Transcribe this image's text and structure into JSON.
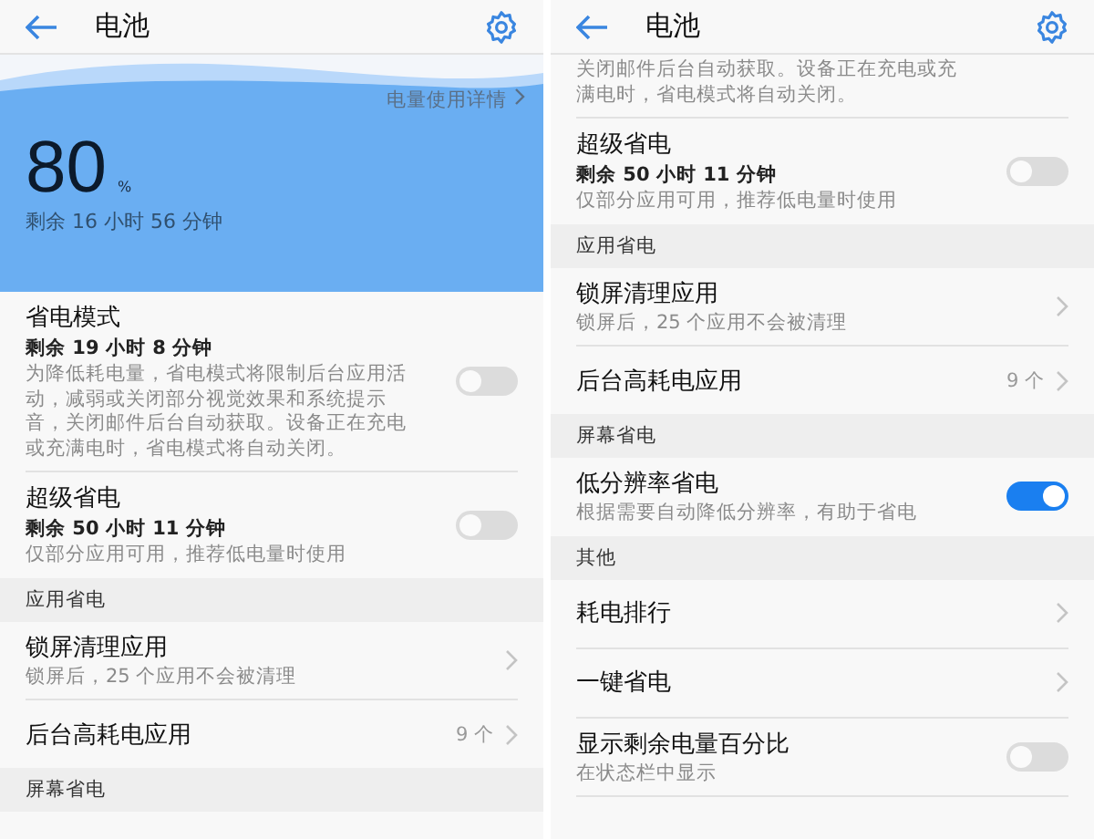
{
  "screens": [
    {
      "title": "电池",
      "hero": {
        "percent": "80",
        "unit": "%",
        "remaining": "剩余 16 小时 56 分钟",
        "details_link": "电量使用详情"
      },
      "rows": [
        {
          "kind": "toggle",
          "title": "省电模式",
          "subtitle": "剩余 19 小时 8 分钟",
          "description": "为降低耗电量，省电模式将限制后台应用活动，减弱或关闭部分视觉效果和系统提示音，关闭邮件后台自动获取。设备正在充电或充满电时，省电模式将自动关闭。",
          "on": false
        },
        {
          "kind": "toggle",
          "title": "超级省电",
          "subtitle": "剩余 50 小时 11 分钟",
          "description": "仅部分应用可用，推荐低电量时使用",
          "on": false
        },
        {
          "kind": "header",
          "title": "应用省电"
        },
        {
          "kind": "link",
          "title": "锁屏清理应用",
          "description": "锁屏后，25 个应用不会被清理"
        },
        {
          "kind": "link",
          "title": "后台高耗电应用",
          "value": "9 个"
        },
        {
          "kind": "header",
          "title": "屏幕省电"
        }
      ]
    },
    {
      "title": "电池",
      "rows": [
        {
          "kind": "fragment",
          "description": "关闭邮件后台自动获取。设备正在充电或充满电时，省电模式将自动关闭。"
        },
        {
          "kind": "toggle",
          "title": "超级省电",
          "subtitle": "剩余 50 小时 11 分钟",
          "description": "仅部分应用可用，推荐低电量时使用",
          "on": false
        },
        {
          "kind": "header",
          "title": "应用省电"
        },
        {
          "kind": "link",
          "title": "锁屏清理应用",
          "description": "锁屏后，25 个应用不会被清理"
        },
        {
          "kind": "link",
          "title": "后台高耗电应用",
          "value": "9 个"
        },
        {
          "kind": "header",
          "title": "屏幕省电"
        },
        {
          "kind": "toggle",
          "title": "低分辨率省电",
          "description": "根据需要自动降低分辨率，有助于省电",
          "on": true
        },
        {
          "kind": "header",
          "title": "其他"
        },
        {
          "kind": "link",
          "title": "耗电排行"
        },
        {
          "kind": "link",
          "title": "一键省电"
        },
        {
          "kind": "toggle",
          "title": "显示剩余电量百分比",
          "description": "在状态栏中显示",
          "on": false
        }
      ]
    }
  ]
}
